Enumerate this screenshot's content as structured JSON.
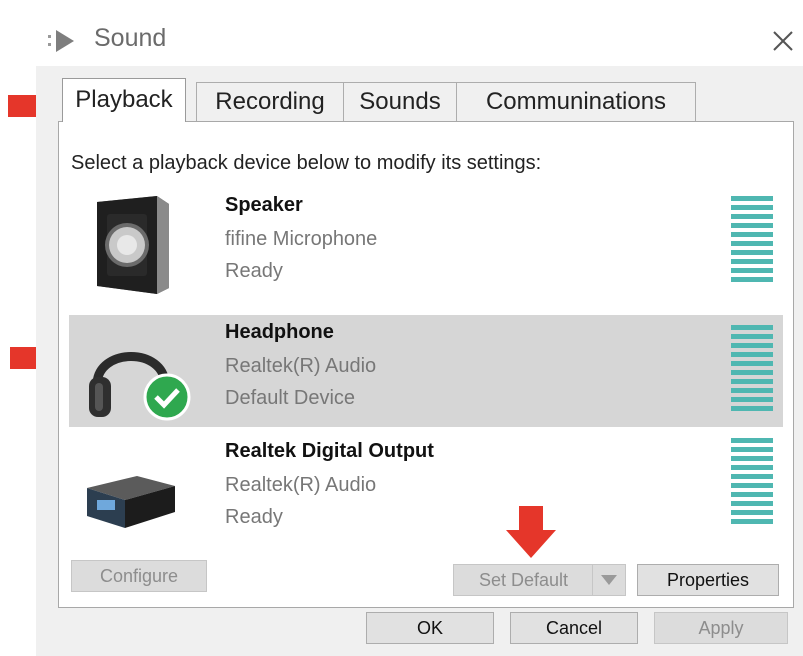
{
  "window": {
    "title": "Sound"
  },
  "tabs": [
    {
      "label": "Playback",
      "active": true
    },
    {
      "label": "Recording",
      "active": false
    },
    {
      "label": "Sounds",
      "active": false
    },
    {
      "label": "Communinations",
      "active": false
    }
  ],
  "playback": {
    "instructions": "Select a playback device below to modify its settings:",
    "devices": [
      {
        "name": "Speaker",
        "line1": "fifine Microphone",
        "line2": "Ready",
        "icon": "speaker-icon",
        "selected": false,
        "default": false
      },
      {
        "name": "Headphone",
        "line1": "Realtek(R) Audio",
        "line2": "Default Device",
        "icon": "headphone-icon",
        "selected": true,
        "default": true
      },
      {
        "name": "Realtek Digital Output",
        "line1": "Realtek(R) Audio",
        "line2": "Ready",
        "icon": "digital-output-icon",
        "selected": false,
        "default": false
      }
    ],
    "buttons": {
      "configure": "Configure",
      "set_default": "Set Default",
      "properties": "Properties"
    }
  },
  "dialog_buttons": {
    "ok": "OK",
    "cancel": "Cancel",
    "apply": "Apply"
  },
  "colors": {
    "annotation_arrow": "#e5362a",
    "level_meter": "#4fb7b1",
    "default_check": "#2fa84f",
    "selection": "#d6d6d6"
  }
}
